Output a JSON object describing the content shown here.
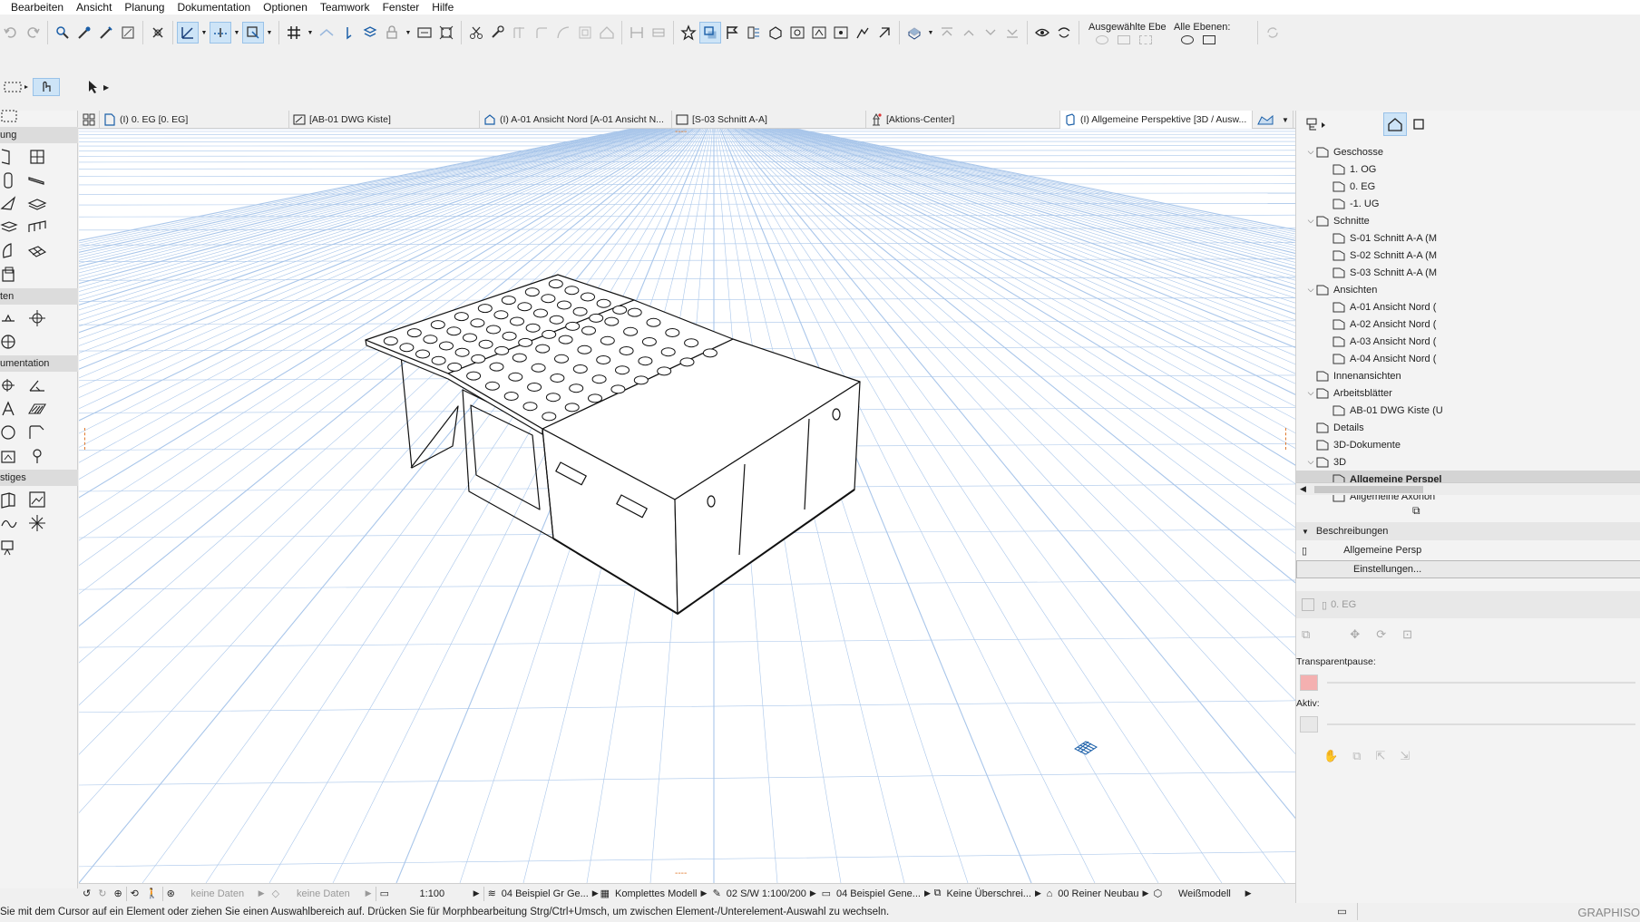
{
  "menu": [
    "Bearbeiten",
    "Ansicht",
    "Planung",
    "Dokumentation",
    "Optionen",
    "Teamwork",
    "Fenster",
    "Hilfe"
  ],
  "layers": {
    "selected_label": "Ausgewählte Ebe",
    "all_label": "Alle Ebenen:"
  },
  "tabs": [
    {
      "label": "(I) 0. EG [0. EG]",
      "icon": "floorplan-icon"
    },
    {
      "label": "[AB-01 DWG Kiste]",
      "icon": "worksheet-icon"
    },
    {
      "label": "(I) A-01 Ansicht Nord [A-01 Ansicht N...",
      "icon": "elevation-icon"
    },
    {
      "label": "[S-03 Schnitt A-A]",
      "icon": "section-icon"
    },
    {
      "label": "[Aktions-Center]",
      "icon": "action-center-icon"
    },
    {
      "label": "(I) Allgemeine Perspektive [3D / Ausw...",
      "icon": "3d-icon",
      "close": "✕"
    }
  ],
  "toolbox": {
    "sections": [
      "ung",
      "ten",
      "umentation",
      "stiges"
    ]
  },
  "navigator": {
    "tree": [
      {
        "label": "Geschosse",
        "level": 0,
        "expanded": true,
        "icon": "folder-icon"
      },
      {
        "label": "1. OG",
        "level": 1,
        "icon": "story-icon"
      },
      {
        "label": "0. EG",
        "level": 1,
        "icon": "story-icon"
      },
      {
        "label": "-1. UG",
        "level": 1,
        "icon": "story-icon"
      },
      {
        "label": "Schnitte",
        "level": 0,
        "expanded": true,
        "icon": "folder-icon"
      },
      {
        "label": "S-01 Schnitt A-A (M",
        "level": 1,
        "icon": "section-icon"
      },
      {
        "label": "S-02 Schnitt A-A (M",
        "level": 1,
        "icon": "section-icon"
      },
      {
        "label": "S-03 Schnitt A-A (M",
        "level": 1,
        "icon": "section-icon"
      },
      {
        "label": "Ansichten",
        "level": 0,
        "expanded": true,
        "icon": "folder-icon"
      },
      {
        "label": "A-01 Ansicht Nord (",
        "level": 1,
        "icon": "elevation-icon"
      },
      {
        "label": "A-02 Ansicht Nord (",
        "level": 1,
        "icon": "elevation-icon"
      },
      {
        "label": "A-03 Ansicht Nord (",
        "level": 1,
        "icon": "elevation-icon"
      },
      {
        "label": "A-04 Ansicht Nord (",
        "level": 1,
        "icon": "elevation-icon"
      },
      {
        "label": "Innenansichten",
        "level": 0,
        "icon": "interior-icon"
      },
      {
        "label": "Arbeitsblätter",
        "level": 0,
        "expanded": true,
        "icon": "folder-icon"
      },
      {
        "label": "AB-01 DWG Kiste (U",
        "level": 1,
        "icon": "worksheet-icon"
      },
      {
        "label": "Details",
        "level": 0,
        "icon": "details-icon"
      },
      {
        "label": "3D-Dokumente",
        "level": 0,
        "icon": "3d-doc-icon"
      },
      {
        "label": "3D",
        "level": 0,
        "expanded": true,
        "icon": "3d-icon"
      },
      {
        "label": "Allgemeine Perspel",
        "level": 1,
        "selected": true,
        "icon": "perspective-icon"
      },
      {
        "label": "Allgemeine Axonon",
        "level": 1,
        "icon": "axonometry-icon"
      }
    ],
    "descriptions_label": "Beschreibungen",
    "description_value": "Allgemeine Persp",
    "settings_button": "Einstellungen...",
    "story_value": "0. EG",
    "transparent_label": "Transparentpause:",
    "active_label": "Aktiv:"
  },
  "viewbar": {
    "items": [
      "keine Daten",
      "keine Daten",
      "1:100",
      "04 Beispiel Gr Ge...",
      "Komplettes Modell",
      "02 S/W 1:100/200",
      "04 Beispiel Gene...",
      "Keine Überschrei...",
      "00 Reiner Neubau",
      "Weißmodell"
    ]
  },
  "status": {
    "message": "Sie mit dem Cursor auf ein Element oder ziehen Sie einen Auswahlbereich auf. Drücken Sie für Morphbearbeitung Strg/Ctrl+Umsch, um zwischen Element-/Unterelement-Auswahl zu wechseln.",
    "brand": "GRAPHISO"
  },
  "colors": {
    "grid_line": "#a9c6ea",
    "active_tab": "#ffffff",
    "accent_active": "#cde4f7",
    "model_stroke": "#111111"
  }
}
